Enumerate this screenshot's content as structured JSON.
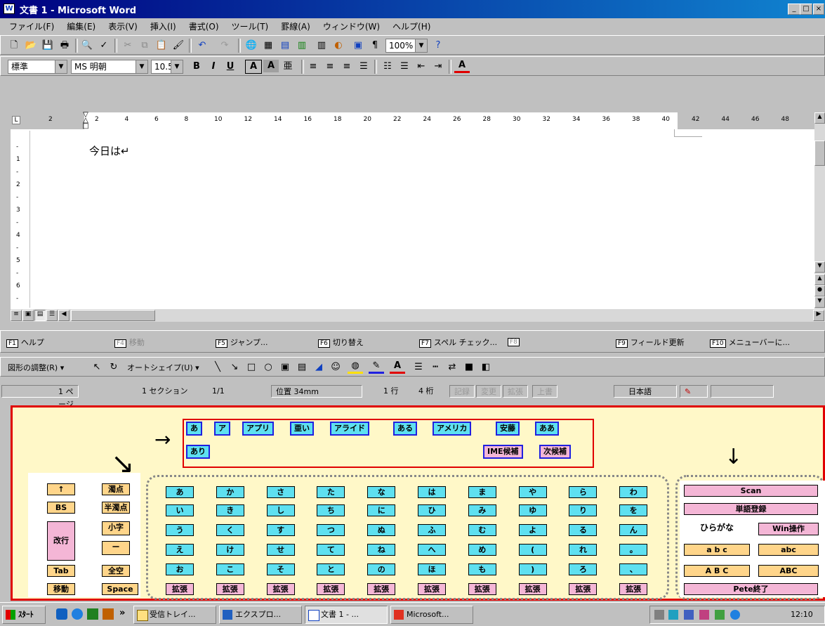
{
  "window": {
    "title": "文書 1 - Microsoft Word",
    "min": "_",
    "max": "□",
    "close": "×"
  },
  "menu": [
    "ファイル(F)",
    "編集(E)",
    "表示(V)",
    "挿入(I)",
    "書式(O)",
    "ツール(T)",
    "罫線(A)",
    "ウィンドウ(W)",
    "ヘルプ(H)"
  ],
  "toolbar1": {
    "zoom": "100%"
  },
  "toolbar2": {
    "style": "標準",
    "font": "MS 明朝",
    "size": "10.5",
    "bold": "B",
    "italic": "I",
    "underline": "U",
    "charframe": "A",
    "charshade": "A",
    "phonetic": "亜"
  },
  "ruler": {
    "ticks": [
      "2",
      "2",
      "4",
      "6",
      "8",
      "10",
      "12",
      "14",
      "16",
      "18",
      "20",
      "22",
      "24",
      "26",
      "28",
      "30",
      "32",
      "34",
      "36",
      "38",
      "40",
      "42",
      "44",
      "46",
      "48"
    ]
  },
  "vruler": [
    "-",
    "1",
    "-",
    "2",
    "-",
    "3",
    "-",
    "4",
    "-",
    "5",
    "-",
    "6",
    "-"
  ],
  "document": {
    "text": "今日は↵"
  },
  "fkeys": [
    {
      "key": "F1",
      "label": "ヘルプ",
      "enabled": true
    },
    {
      "key": "F4",
      "label": "移動",
      "enabled": false
    },
    {
      "key": "F5",
      "label": "ジャンプ...",
      "enabled": true
    },
    {
      "key": "F6",
      "label": "切り替え",
      "enabled": true
    },
    {
      "key": "F7",
      "label": "スペル チェック...",
      "enabled": true
    },
    {
      "key": "F8",
      "label": "",
      "enabled": false
    },
    {
      "key": "F9",
      "label": "フィールド更新",
      "enabled": true
    },
    {
      "key": "F10",
      "label": "メニューバーに...",
      "enabled": true
    }
  ],
  "drawbar": {
    "adjust": "図形の調整(R)",
    "autoshape": "オートシェイプ(U)"
  },
  "status": {
    "page": "1 ページ",
    "section": "1 セクション",
    "pages": "1/1",
    "pos": "位置 34mm",
    "line": "1 行",
    "col": "4 桁",
    "rec": "記録",
    "trk": "変更",
    "ext": "拡張",
    "ovr": "上書",
    "lang": "日本語"
  },
  "candidates": {
    "row1": [
      "あ",
      "ア",
      "アプリ",
      "亜い",
      "アライド",
      "ある",
      "アメリカ",
      "安藤",
      "ああ"
    ],
    "row2": [
      "あり"
    ],
    "ime": "IME候補",
    "next": "次候補"
  },
  "leftkeys": {
    "up": "↑",
    "dakuten": "濁点",
    "bs": "BS",
    "handaku": "半濁点",
    "small": "小字",
    "enter": "改行",
    "bar": "ー",
    "tab": "Tab",
    "zenkaku": "全空",
    "move": "移動",
    "space": "Space"
  },
  "kana": {
    "rows": [
      [
        "あ",
        "か",
        "さ",
        "た",
        "な",
        "は",
        "ま",
        "や",
        "ら",
        "わ"
      ],
      [
        "い",
        "き",
        "し",
        "ち",
        "に",
        "ひ",
        "み",
        "ゆ",
        "り",
        "を"
      ],
      [
        "う",
        "く",
        "す",
        "つ",
        "ぬ",
        "ふ",
        "む",
        "よ",
        "る",
        "ん"
      ],
      [
        "え",
        "け",
        "せ",
        "て",
        "ね",
        "へ",
        "め",
        "(",
        "れ",
        "。"
      ],
      [
        "お",
        "こ",
        "そ",
        "と",
        "の",
        "ほ",
        "も",
        ")",
        "ろ",
        "、"
      ]
    ],
    "expand": "拡張"
  },
  "rightpanel": {
    "scan": "Scan",
    "register": "単語登録",
    "hira": "ひらがな",
    "win": "Win操作",
    "abc1": "a b c",
    "abc2": "abc",
    "ABC1": "A B C",
    "ABC2": "ABC",
    "exit": "Pete終了"
  },
  "taskbar": {
    "start": "ｽﾀｰﾄ",
    "chevron": "»",
    "tasks": [
      "受信トレイ...",
      "エクスプロ...",
      "文書 1 - ...",
      "Microsoft..."
    ],
    "clock": "12:10"
  },
  "colors": {
    "title": "#000080",
    "keyboardBorder": "#e00000",
    "keyboardBg": "#fff8c8",
    "cyan": "#5ee0f0",
    "pink": "#f4b6d6",
    "orange": "#ffd58a"
  }
}
